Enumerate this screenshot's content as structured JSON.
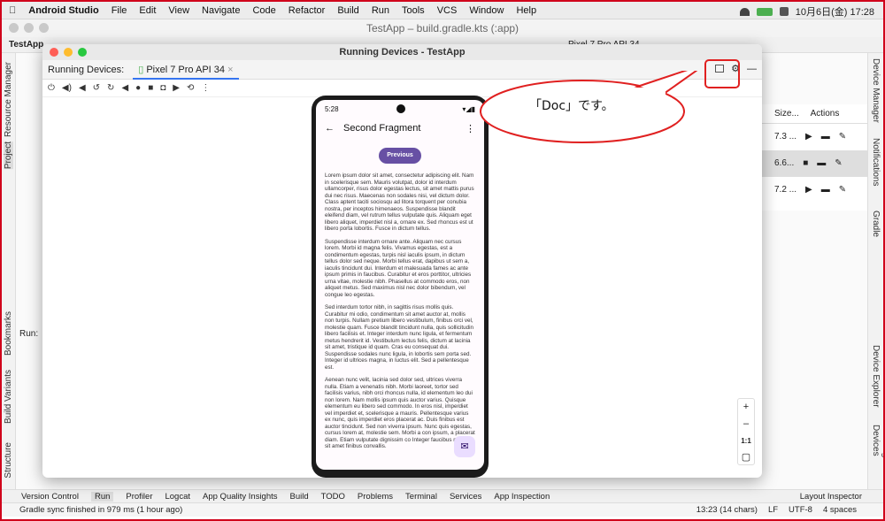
{
  "menubar": {
    "app": "Android Studio",
    "items": [
      "File",
      "Edit",
      "View",
      "Navigate",
      "Code",
      "Refactor",
      "Build",
      "Run",
      "Tools",
      "VCS",
      "Window",
      "Help"
    ],
    "clock": "10月6日(金)  17:28"
  },
  "window": {
    "title": "TestApp – build.gradle.kts (:app)"
  },
  "toolbar": {
    "project": "TestApp",
    "device": "Pixel 7 Pro API 34"
  },
  "left_tabs": [
    "Resource Manager",
    "Project",
    "Bookmarks",
    "Build Variants",
    "Structure"
  ],
  "right_tabs": [
    "Device Manager",
    "Notifications",
    "Gradle",
    "Device Explorer",
    "Running Devices"
  ],
  "device_panel": {
    "col_size": "Size...",
    "col_actions": "Actions",
    "rows": [
      {
        "size": "7.3 ..."
      },
      {
        "size": "6.6..."
      },
      {
        "size": "7.2 ..."
      }
    ]
  },
  "run_window": {
    "title": "Running Devices - TestApp",
    "tab_label": "Running Devices:",
    "device_tab": "Pixel 7 Pro API 34",
    "zoom_ratio": "1:1"
  },
  "phone": {
    "time": "5:28",
    "screen_title": "Second Fragment",
    "button": "Previous",
    "paragraphs": [
      "Lorem ipsum dolor sit amet, consectetur adipiscing elit. Nam in scelerisque sem. Mauris volutpat, dolor id interdum ullamcorper, risus dolor egestas lectus, sit amet mattis purus dui nec risus. Maecenas non sodales nisi, vel dictum dolor. Class aptent taciti sociosqu ad litora torquent per conubia nostra, per inceptos himenaeos. Suspendisse blandit eleifend diam, vel rutrum tellus vulputate quis. Aliquam eget libero aliquet, imperdiet nisl a, ornare ex. Sed rhoncus est ut libero porta lobortis. Fusce in dictum tellus.",
      "Suspendisse interdum ornare ante. Aliquam nec cursus lorem. Morbi id magna felis. Vivamus egestas, est a condimentum egestas, turpis nisl iaculis ipsum, in dictum tellus dolor sed neque. Morbi tellus erat, dapibus ut sem a, iaculis tincidunt dui. Interdum et malesuada fames ac ante ipsum primis in faucibus. Curabitur et eros porttitor, ultricies urna vitae, molestie nibh. Phasellus at commodo eros, non aliquet metus. Sed maximus nisl nec dolor bibendum, vel congue leo egestas.",
      "Sed interdum tortor nibh, in sagittis risus mollis quis. Curabitur mi odio, condimentum sit amet auctor at, mollis non turpis. Nullam pretium libero vestibulum, finibus orci vel, molestie quam. Fusce blandit tincidunt nulla, quis sollicitudin libero facilisis et. Integer interdum nunc ligula, et fermentum metus hendrerit id. Vestibulum lectus felis, dictum at lacinia sit amet, tristique id quam. Cras eu consequat dui. Suspendisse sodales nunc ligula, in lobortis sem porta sed. Integer id ultrices magna, in luctus elit. Sed a pellentesque est.",
      "Aenean nunc velit, lacinia sed dolor sed, ultrices viverra nulla. Etiam a venenatis nibh. Morbi laoreet, tortor sed facilisis varius, nibh orci rhoncus nulla, id elementum leo dui non lorem. Nam mollis ipsum quis auctor varius. Quisque elementum eu libero sed commodo. In eros nisl, imperdiet vel imperdiet et, scelerisque a mauris. Pellentesque varius ex nunc, quis imperdiet eros placerat ac. Duis finibus est auctor tincidunt. Sed non viverra ipsum. Nunc quis egestas, cursus lorem at, molestie sem. Morbi a con ipsum, a placerat diam. Etiam vulputate dignissim co Integer faucibus mauris sit amet finibus convallis."
    ]
  },
  "callout": {
    "text": "「Doc」です。"
  },
  "run_panel": {
    "label": "Run:"
  },
  "bottom_tabs": [
    "Version Control",
    "Run",
    "Profiler",
    "Logcat",
    "App Quality Insights",
    "Build",
    "TODO",
    "Problems",
    "Terminal",
    "Services",
    "App Inspection",
    "Layout Inspector"
  ],
  "status": {
    "message": "Gradle sync finished in 979 ms (1 hour ago)",
    "position": "13:23 (14 chars)",
    "line_sep": "LF",
    "encoding": "UTF-8",
    "indent": "4 spaces"
  },
  "colors": {
    "accent": "#3574f0",
    "button": "#6750a4",
    "callout_border": "#e02020"
  }
}
